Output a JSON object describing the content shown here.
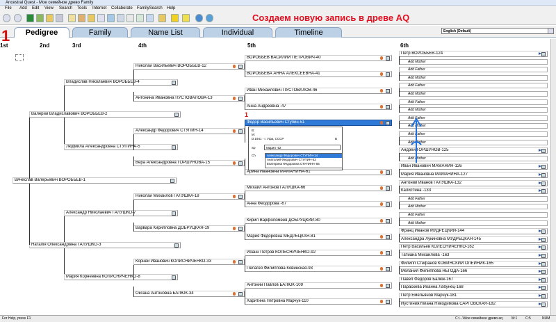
{
  "window": {
    "title": "Ancestral Quest - Мое семейное древо Family"
  },
  "menu": [
    "File",
    "Add",
    "Edit",
    "View",
    "Search",
    "Tools",
    "Internet",
    "Collaborate",
    "FamilySearch",
    "Help"
  ],
  "headline": "Создаем новую запись в древе AQ",
  "tabs": [
    "Pedigree",
    "Family",
    "Name List",
    "Individual",
    "Timeline"
  ],
  "language": "English (Default)",
  "gen_marker": "1",
  "columns": [
    "1st",
    "2nd",
    "3rd",
    "4th",
    "5th",
    "6th"
  ],
  "small_marker": "1",
  "gen1": "Вячеслав Валерьевич ВОРОБЬЁВ-1",
  "gen2": [
    "Валерий Владиславович ВОРОБЬЕВ-2",
    "Наталія Олександрівна ГАЛУШКО-3"
  ],
  "gen3": [
    "Владислав Николаевич ВОРОБЬЕВ-4",
    "Людмила Александровна СТУПИНА-5",
    "Александр Николаевич ГАЛУШКО-7",
    "Мария Корнеевна КОЛИСНИЧЕНКО-8"
  ],
  "gen4": [
    "Николай Васильевич ВОРОБЬЕВ-12",
    "Антонина Ивановна ПУСТОВАЛОВА-13",
    "Александр Федорович СТУПИН-14",
    "Вера Александровна ГОРШУНОВА-15",
    "Николай Михайлов ГАЛУШКА-18",
    "Варвара Кирилловна ДОБРУЦКАЯ-19",
    "Корней Иванович КОЛИСНИЧЕНКО-33",
    "Оксана Антоновна БАЛЮК-34"
  ],
  "gen5": [
    "ВОРОБЬЕВ ВАСИЛИЙ ПЕТРОВИЧ-40",
    "ВОРОБЬЕВА АННА АЛЕКСЕЕВНА-41",
    "Иван Михайлович ПУСТОВАЛОВ-46",
    "Анна Андреевна -47",
    "Федор Васильевич Ступин-51",
    "",
    "",
    "Арина Ивановна МАМАНИНА-61",
    "Михаил Антонов ГАЛУШКА-66",
    "Анна Феодорова -67",
    "Кирил Варфоломеев ДОБРУЦКИЙ-80",
    "Мария Федоровна МЕДРЕЦКАЯ-81",
    "Иоанн Петров КОЛЕСНИЧЕНКО-92",
    "Пелагея Филиппова Ковинская-93",
    "Антоний Павлов БАЛЮК-109",
    "Харитина Петровна Марчук-110"
  ],
  "gen6": [
    "Петр ВОРОБЬЕВ-124",
    "Add Mother",
    "Add Father",
    "Add Mother",
    "Add Father",
    "Add Mother",
    "Add Father",
    "Add Mother",
    "Add Father",
    "Add Mother",
    "Add Father",
    "Add Mother",
    "Андрей ГОРШУНОВ-125",
    "Add Mother",
    "Иван Иванович МАМАНИН-126",
    "Мария Ивановна МАМАНИНА-127",
    "Антоний Иванов ГАЛУШКА-132",
    "Калистина -133",
    "Add Father",
    "Add Mother",
    "Add Father",
    "Add Mother",
    "Франц Иванов МУДРЕЦКИЙ-144",
    "Александра Лукиновна МУДРЕЦКАЯ-145",
    "Петр Васильев КОЛЕСНИЧЕНКО-162",
    "Татиана Михайлова -163",
    "Филипп Стефанов КОВИНСКИЙ ОЛЕЙНИК-165",
    "Мелания Филиппова НЕГОДА-166",
    "Павел Федоров Балюк-167",
    "Параскева Иоанна Лабунец-168",
    "Петр Емельянов Марчук-181",
    "ИустинияУлиана Никодимова САРГОВСКАЯ-182"
  ],
  "popup": {
    "b": "B:",
    "m": "M:",
    "d": "D:1941 - г. Уфа, СССР",
    "d_right": "B",
    "sp_label": "Sp",
    "sp_value": "Мария -52",
    "ch_label": "Ch",
    "children": [
      "Александр Федорович СТУПИН-14",
      "Анатолий Федорович СТУПИН-53",
      "Екатерина Федоровна СТУПИНА-55"
    ]
  },
  "status": {
    "left": "For Help, press F1",
    "file": "C:\\...\\Мое семейное древо.aq",
    "m": "M:1",
    "c": "C:5",
    "num": "NUM"
  }
}
